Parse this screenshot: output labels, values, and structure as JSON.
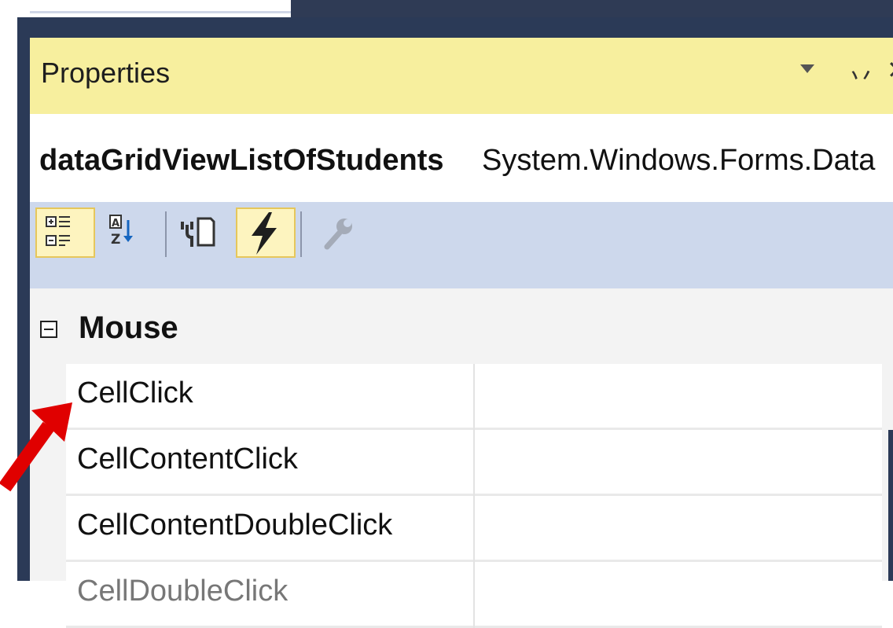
{
  "panel": {
    "title": "Properties",
    "selected_object_name": "dataGridViewListOfStudents",
    "selected_object_type": "System.Windows.Forms.Data",
    "pin_icon_glyph": "丷",
    "close_glyph": "✕"
  },
  "toolbar": {
    "buttons": [
      {
        "name": "categorized",
        "icon": "categorized-icon",
        "active": true
      },
      {
        "name": "alphabetical",
        "icon": "alphabetical-sort-icon",
        "active": false
      },
      {
        "name": "properties",
        "icon": "properties-icon",
        "active": false
      },
      {
        "name": "events",
        "icon": "lightning-icon",
        "active": true
      },
      {
        "name": "property-pages",
        "icon": "wrench-icon",
        "active": false,
        "disabled": true
      }
    ]
  },
  "grid": {
    "category": {
      "label": "Mouse",
      "expanded": true
    },
    "rows": [
      {
        "name": "CellClick",
        "value": ""
      },
      {
        "name": "CellContentClick",
        "value": ""
      },
      {
        "name": "CellContentDoubleClick",
        "value": ""
      },
      {
        "name": "CellDoubleClick",
        "value": ""
      }
    ]
  },
  "annotation": {
    "arrow_color": "#e00000"
  },
  "colors": {
    "title_bar": "#f7ef9e",
    "toolbar": "#cdd8ec",
    "frame": "#2b3a57",
    "active_button": "#fdf4bf"
  }
}
